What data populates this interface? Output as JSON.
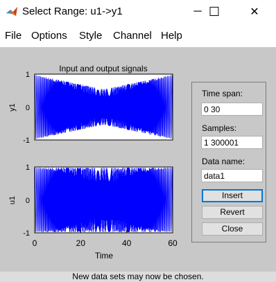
{
  "window": {
    "title": "Select Range: u1->y1",
    "app_icon": "matlab-icon",
    "controls": {
      "minimize": "─",
      "maximize": "☐",
      "close": "✕"
    }
  },
  "menu": [
    {
      "label": "File"
    },
    {
      "label": "Options"
    },
    {
      "label": "Style"
    },
    {
      "label": "Channel"
    },
    {
      "label": "Help"
    }
  ],
  "panel": {
    "time_span_label": "Time span:",
    "time_span_value": "0 30",
    "samples_label": "Samples:",
    "samples_value": "1 300001",
    "data_name_label": "Data name:",
    "data_name_value": "data1",
    "insert_label": "Insert",
    "revert_label": "Revert",
    "close_label": "Close"
  },
  "status": {
    "text": "New data sets may now be chosen."
  },
  "colors": {
    "signal": "#0000ff",
    "figure_bg": "#c8c8c8",
    "focus": "#0078d7"
  },
  "chart_data": [
    {
      "type": "line",
      "title": "Input and output signals",
      "ylabel": "y1",
      "xlabel": "",
      "xlim": [
        0,
        60
      ],
      "ylim": [
        -1,
        1
      ],
      "yticks": [
        "1",
        "0",
        "-1"
      ],
      "xticks": [],
      "series": [
        {
          "description": "dense oscillation, envelope narrows to about ±0.55 near x=30",
          "min_envelope": 0.55,
          "at_x": 30
        }
      ]
    },
    {
      "type": "line",
      "title": "",
      "ylabel": "u1",
      "xlabel": "Time",
      "xlim": [
        0,
        60
      ],
      "ylim": [
        -1,
        1
      ],
      "yticks": [
        "1",
        "0",
        "-1"
      ],
      "xticks": [
        "0",
        "20",
        "40",
        "60"
      ],
      "series": [
        {
          "description": "dense oscillation with full ±1 amplitude",
          "amplitude": 1
        }
      ]
    }
  ]
}
